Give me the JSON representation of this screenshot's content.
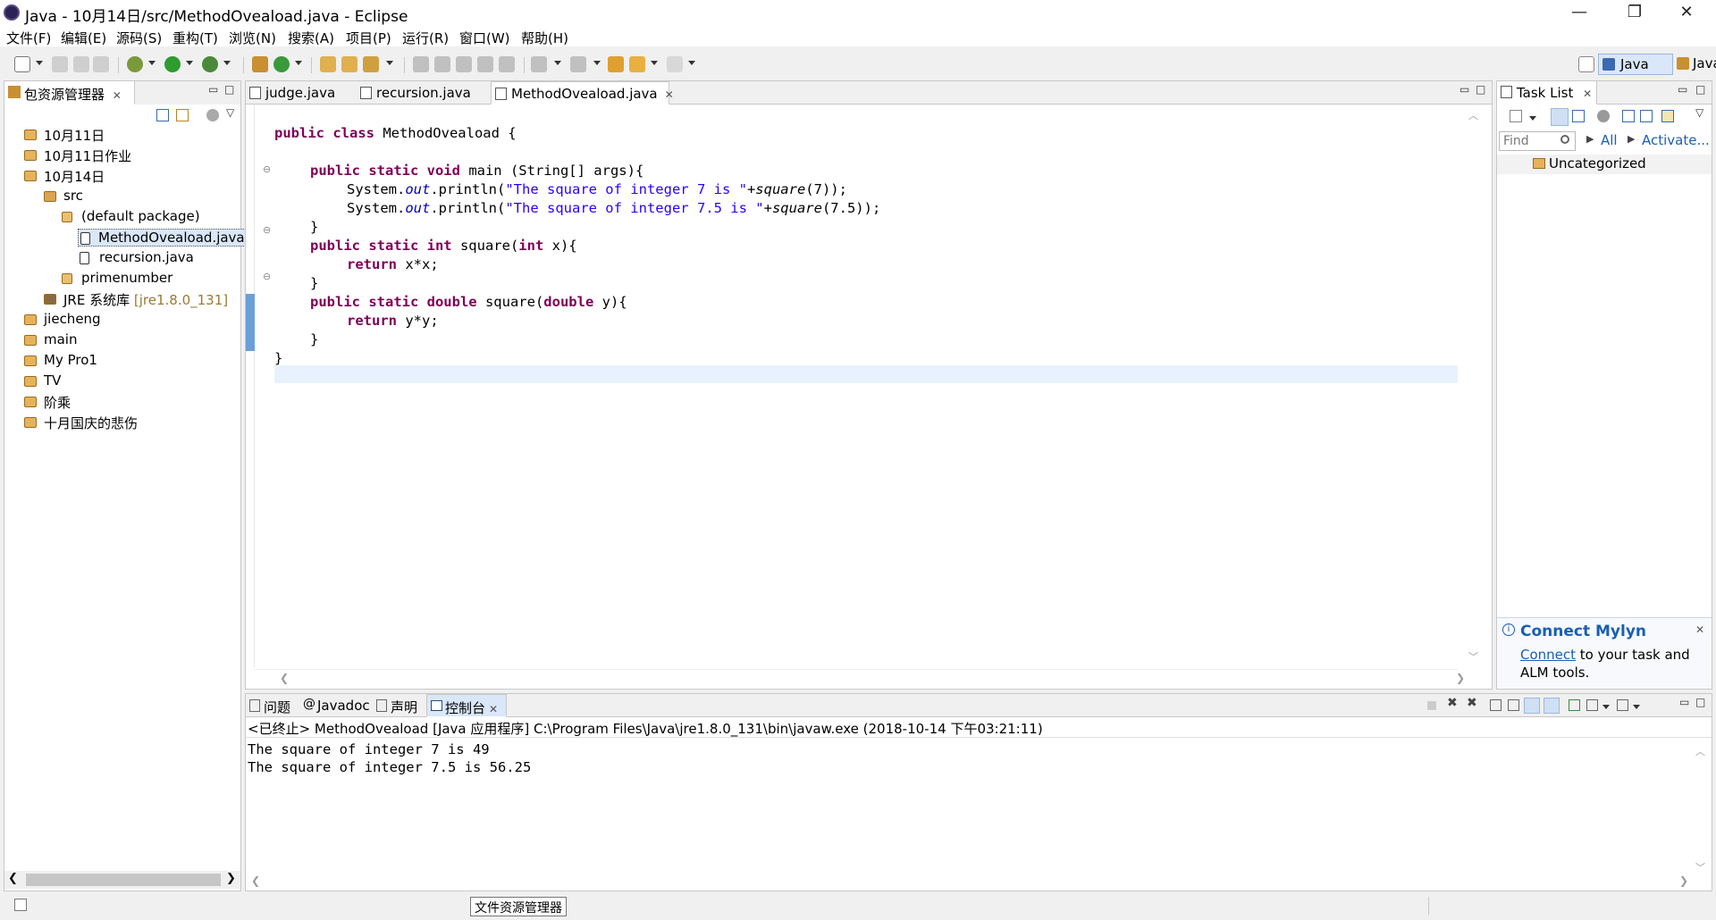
{
  "window": {
    "title": "Java - 10月14日/src/MethodOveaload.java - Eclipse",
    "minimize": "—",
    "restore": "❐",
    "close": "✕"
  },
  "menu": [
    "文件(F)",
    "编辑(E)",
    "源码(S)",
    "重构(T)",
    "浏览(N)",
    "搜索(A)",
    "项目(P)",
    "运行(R)",
    "窗口(W)",
    "帮助(H)"
  ],
  "perspectives": [
    "Java",
    "Java"
  ],
  "explorer": {
    "title": "包资源管理器",
    "items": [
      {
        "label": "10月11日",
        "level": 0
      },
      {
        "label": "10月11日作业",
        "level": 0
      },
      {
        "label": "10月14日",
        "level": 0
      },
      {
        "label": "src",
        "level": 1
      },
      {
        "label": "(default package)",
        "level": 2
      },
      {
        "label": "MethodOveaload.java",
        "level": 3
      },
      {
        "label": "recursion.java",
        "level": 3
      },
      {
        "label": "primenumber",
        "level": 2
      },
      {
        "label": "JRE 系统库",
        "extra": "[jre1.8.0_131]",
        "level": 1
      },
      {
        "label": "jiecheng",
        "level": 0
      },
      {
        "label": "main",
        "level": 0
      },
      {
        "label": "My Pro1",
        "level": 0
      },
      {
        "label": "TV",
        "level": 0
      },
      {
        "label": "阶乘",
        "level": 0
      },
      {
        "label": "十月国庆的悲伤",
        "level": 0
      }
    ]
  },
  "editor": {
    "tabs": [
      "judge.java",
      "recursion.java",
      "MethodOveaload.java"
    ],
    "code": {
      "class_kw": "public class",
      "class_name": " MethodOveaload {",
      "main_kw": "public static void",
      "main_sig": " main (String[] args){",
      "sys1_a": "System.",
      "sys_out": "out",
      "sys1_b": ".println(",
      "str1": "\"The square of integer 7 is \"",
      "plus1": "+",
      "call1": "square",
      "arg1": "(7));",
      "str2": "\"The square of integer 7.5 is \"",
      "arg2": "(7.5));",
      "close_brace": "}",
      "sq_int_kw": "public static int",
      "sq_int_name": " square(",
      "int_kw": "int",
      "sq_int_param": " x){",
      "return_kw": "return",
      "ret_x": " x*x;",
      "sq_dbl_kw": "public static double",
      "sq_dbl_name": " square(",
      "double_kw": "double",
      "sq_dbl_param": " y){",
      "ret_y": " y*y;"
    }
  },
  "tasklist": {
    "title": "Task List",
    "find_placeholder": "Find",
    "all": "All",
    "activate": "Activate...",
    "uncategorized": "Uncategorized"
  },
  "mylyn": {
    "title": "Connect Mylyn",
    "link": "Connect",
    "text1": " to your task and",
    "text2": "ALM tools."
  },
  "console": {
    "tabs": [
      "问题",
      "Javadoc",
      "声明",
      "控制台"
    ],
    "header": "<已终止> MethodOveaload [Java 应用程序] C:\\Program Files\\Java\\jre1.8.0_131\\bin\\javaw.exe  (2018-10-14 下午03:21:11)",
    "lines": [
      "The square of integer 7 is 49",
      "The square of integer 7.5 is 56.25"
    ]
  },
  "statusbar": {
    "tooltip": "文件资源管理器"
  }
}
